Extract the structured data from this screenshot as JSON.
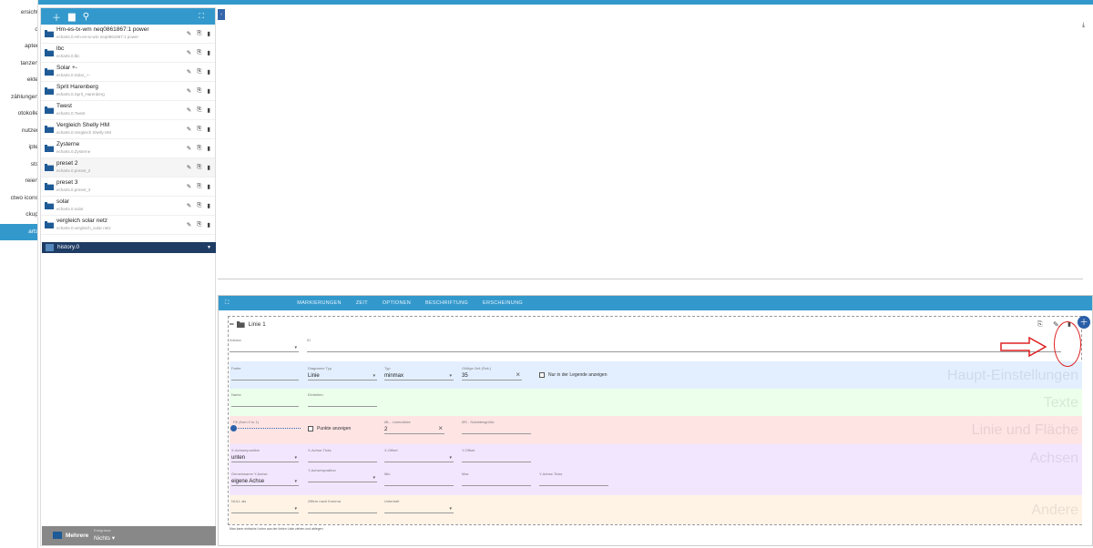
{
  "nav": {
    "items": [
      {
        "label": "ersicht",
        "active": false
      },
      {
        "label": "o",
        "active": false
      },
      {
        "label": "apter",
        "active": false
      },
      {
        "label": "tanzen",
        "active": false
      },
      {
        "label": "ekte",
        "active": false
      },
      {
        "label": "zählungen",
        "active": false
      },
      {
        "label": "otokolle",
        "active": false
      },
      {
        "label": "nutzer",
        "active": false
      },
      {
        "label": "ipte",
        "active": false
      },
      {
        "label": "sts",
        "active": false
      },
      {
        "label": "reien",
        "active": false
      },
      {
        "label": "ctwo icons",
        "active": false
      },
      {
        "label": "ckup",
        "active": false
      },
      {
        "label": "arts",
        "active": true
      }
    ]
  },
  "charts": [
    {
      "name": "Hm-es-tx-wm neq0861867:1 power",
      "path": "echarts.0.Hm-es-tx-wm neq0861867:1 power"
    },
    {
      "name": "lbc",
      "path": "echarts.0.lbc"
    },
    {
      "name": "Solar +-",
      "path": "echarts.0.Solar_+-"
    },
    {
      "name": "Sprit Harenberg",
      "path": "echarts.0.Sprit_Harenberg"
    },
    {
      "name": "Twest",
      "path": "echarts.0.Twest"
    },
    {
      "name": "Vergleich Shelly HM",
      "path": "echarts.0.Vergleich Shelly HM"
    },
    {
      "name": "Zysterne",
      "path": "echarts.0.Zysterne"
    },
    {
      "name": "preset 2",
      "path": "echarts.0.preset_2"
    },
    {
      "name": "preset 3",
      "path": "echarts.0.preset_3"
    },
    {
      "name": "solar",
      "path": "echarts.0.solar"
    },
    {
      "name": "vergleich solar netz",
      "path": "echarts.0.vergleich_solar netz"
    }
  ],
  "history": {
    "label": "history.0"
  },
  "bottom": {
    "mehrere": "Mehrere",
    "label": "Ereignisse",
    "value": "Nichts"
  },
  "tabs": [
    "MARKIERUNGEN",
    "ZEIT",
    "OPTIONEN",
    "BESCHRIFTUNG",
    "ERSCHEINUNG"
  ],
  "line": {
    "title": "Linie 1",
    "instanz_label": "Instanz",
    "id_label": "ID",
    "farbe_label": "Farbe",
    "diagramm_label": "Diagramm Typ",
    "diagramm_value": "Linie",
    "typ_label": "Typ",
    "typ_value": "minmax",
    "zeit_label": "Gültige Zeit (Sek.)",
    "zeit_value": "35",
    "legende_label": "Nur in der Legende anzeigen",
    "name_label": "Name",
    "einheiten_label": "Einheiten",
    "fill_label": "Fill (from 0 to 1)",
    "punkte_label": "Punkte anzeigen",
    "linien_label": "ØL - Liniendicke",
    "linien_value": "2",
    "schatten_label": "ØS - Schattengröße",
    "xpos_label": "X-Achsenposition",
    "xpos_value": "unten",
    "xticks_label": "X-Achse-Ticks",
    "xoff_label": "X-Offset",
    "yoff_label": "Y-Offset",
    "gemeinsame_label": "Gemeinsame Y-Achse",
    "gemeinsame_value": "eigene Achse",
    "ypos_label": "Y-Achsenposition",
    "min_label": "Min",
    "max_label": "Max",
    "yticks_label": "Y-Achse-Ticks",
    "null_label": "NULL als",
    "ziffern_label": "Ziffern nach Komma",
    "unterhalt_label": "Unterhalt",
    "footnote": "Man kann einfache Linien aus der linken Liste ziehen und ablegen"
  },
  "sections": {
    "haupt": "Haupt-Einstellungen",
    "texte": "Texte",
    "linie": "Linie und Fläche",
    "achsen": "Achsen",
    "andere": "Andere"
  },
  "colors": {
    "accent": "#3399cc",
    "haupt": "#e3efff",
    "texte": "#ebffeb",
    "linie": "#ffe4e4",
    "achsen": "#f2e6ff",
    "andere": "#fff3e6",
    "annotation": "#dd2222"
  }
}
